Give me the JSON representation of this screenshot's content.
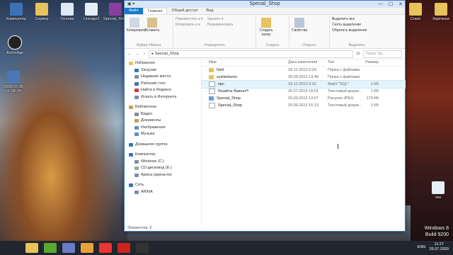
{
  "desktop": {
    "icons_left": [
      {
        "label": "Компьютер",
        "icon": "computer-icon",
        "color": "#3b73b9"
      },
      {
        "label": "Сервер",
        "icon": "folder-icon",
        "color": "#e8c25a"
      },
      {
        "label": "Основа",
        "icon": "document-icon",
        "color": "#dfe8f5"
      },
      {
        "label": "Lineage2",
        "icon": "document-icon",
        "color": "#e6eef8"
      },
      {
        "label": "Special_Shop",
        "icon": "archive-icon",
        "color": "#8a3fa0"
      }
    ],
    "archeage_label": "ArcheAge",
    "dated_icon_label": "2020-07-26 11-24-14",
    "icons_right": [
      {
        "label": "Crack",
        "icon": "folder-icon"
      },
      {
        "label": "Картинки",
        "icon": "folder-icon"
      },
      {
        "label": "vse",
        "icon": "document-icon"
      }
    ],
    "windows_label": "Windows 8",
    "build_label": "Build 9200"
  },
  "window": {
    "title": "Special_Shop",
    "tabs": [
      "Файл",
      "Главная",
      "Общий доступ",
      "Вид"
    ],
    "ribbon": {
      "clipboard": {
        "copy": "Копировать",
        "paste": "Вставить",
        "title": "Буфер обмена"
      },
      "organize": {
        "move": "Переместить в ▾",
        "copy_to": "Копировать в ▾",
        "delete": "Удалить ▾",
        "rename": "Переименовать",
        "title": "Упорядочить"
      },
      "create": {
        "new_folder": "Создать папку",
        "title": "Создать"
      },
      "open": {
        "properties": "Свойства",
        "title": "Открыть"
      },
      "select": {
        "select_all": "Выделить все",
        "select_none": "Снять выделение",
        "invert": "Обратить выделение",
        "title": "Выделить"
      }
    },
    "address": {
      "path": "Special_Shop",
      "search_placeholder": "Поиск: Sp..."
    },
    "nav_pane": [
      {
        "label": "Избранное",
        "level": 0,
        "icon": "star-icon",
        "color": "#e8c25a"
      },
      {
        "label": "Загрузки",
        "level": 1,
        "icon": "download-icon",
        "color": "#3b73b9"
      },
      {
        "label": "Недавние места",
        "level": 1,
        "icon": "recent-icon",
        "color": "#7a8fa8"
      },
      {
        "label": "Рабочий стол",
        "level": 1,
        "icon": "desktop-icon",
        "color": "#3b73b9"
      },
      {
        "label": "Найти в Яндексе",
        "level": 1,
        "icon": "yandex-icon",
        "color": "#d33"
      },
      {
        "label": "Искать в Интернете",
        "level": 1,
        "icon": "web-icon",
        "color": "#7a8fa8"
      },
      {
        "label": "Библиотеки",
        "level": 0,
        "icon": "library-icon",
        "color": "#c9a24a",
        "gap": true
      },
      {
        "label": "Видео",
        "level": 1,
        "icon": "video-icon",
        "color": "#7a8fa8"
      },
      {
        "label": "Документы",
        "level": 1,
        "icon": "documents-icon",
        "color": "#c9a24a"
      },
      {
        "label": "Изображения",
        "level": 1,
        "icon": "images-icon",
        "color": "#5a8fc8"
      },
      {
        "label": "Музыка",
        "level": 1,
        "icon": "music-icon",
        "color": "#5a8fc8"
      },
      {
        "label": "Домашняя группа",
        "level": 0,
        "icon": "homegroup-icon",
        "color": "#3b73b9",
        "gap": true
      },
      {
        "label": "Компьютер",
        "level": 0,
        "icon": "computer-icon",
        "color": "#3b73b9",
        "gap": true
      },
      {
        "label": "Windows (C:)",
        "level": 1,
        "icon": "drive-icon",
        "color": "#7a8fa8"
      },
      {
        "label": "CD-дисковод (E:)",
        "level": 1,
        "icon": "cd-icon",
        "color": "#9aa"
      },
      {
        "label": "Арина (арина-пк)",
        "level": 1,
        "icon": "network-drive-icon",
        "color": "#7a8fa8"
      },
      {
        "label": "Сеть",
        "level": 0,
        "icon": "network-icon",
        "color": "#3b73b9",
        "gap": true
      },
      {
        "label": "ARINA",
        "level": 1,
        "icon": "pc-icon",
        "color": "#7a8fa8"
      }
    ],
    "columns": {
      "name": "Имя",
      "date": "Дата изменения",
      "type": "Тип",
      "size": "Размер"
    },
    "files": [
      {
        "name": "html",
        "date": "18.12.2013 0:29",
        "type": "Папка с файлами",
        "size": "",
        "icon": "folder-icon",
        "selected": false
      },
      {
        "name": "sysitextures",
        "date": "20.09.2013 13:48",
        "type": "Папка с файлами",
        "size": "",
        "icon": "folder-icon",
        "selected": false
      },
      {
        "name": "npc",
        "date": "18.12.2013 0:32",
        "type": "Файл \"SQL\"",
        "size": "1 КБ",
        "icon": "document-icon",
        "selected": true
      },
      {
        "name": "Readme Важно!!!",
        "date": "26.07.2014 18:01",
        "type": "Текстовый докум...",
        "size": "1 КБ",
        "icon": "document-icon",
        "selected": false
      },
      {
        "name": "Special_Shop",
        "date": "20.09.2013 13:57",
        "type": "Рисунок JPEG",
        "size": "170 КБ",
        "icon": "image-icon",
        "selected": false
      },
      {
        "name": "Special_Shop",
        "date": "20.09.2013 16:13",
        "type": "Текстовый докум...",
        "size": "1 КБ",
        "icon": "document-icon",
        "selected": false
      }
    ],
    "status": "Элементов: 6"
  },
  "taskbar": {
    "lang": "ENG",
    "time": "11:27",
    "date": "26.07.2020",
    "buttons": [
      {
        "name": "explorer-icon",
        "color": "#e8c25a"
      },
      {
        "name": "browser-green-icon",
        "color": "#5aa832"
      },
      {
        "name": "media-icon",
        "color": "#6a7bc8"
      },
      {
        "name": "chrome-icon",
        "color": "#e8a23a"
      },
      {
        "name": "yandex-browser-icon",
        "color": "#e33"
      },
      {
        "name": "opera-icon",
        "color": "#c22"
      },
      {
        "name": "obs-icon",
        "color": "#333"
      }
    ]
  }
}
